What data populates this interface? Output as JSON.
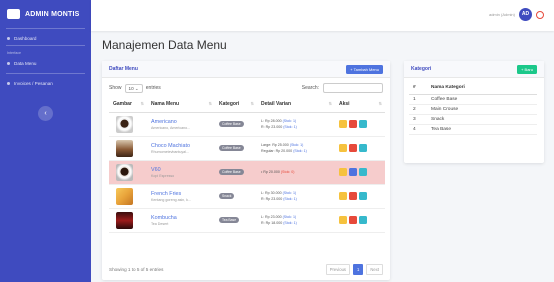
{
  "brand": {
    "name": "ADMIN MONTIS"
  },
  "sidebar": {
    "items": [
      {
        "label": "Dashboard"
      },
      {
        "heading": "Interface"
      },
      {
        "label": "Data Menu"
      },
      {
        "label": "Invoices / Pesanan"
      }
    ]
  },
  "topbar": {
    "user_name": "admin (Admin)",
    "avatar_initials": "AD"
  },
  "page": {
    "title": "Manajemen Data Menu"
  },
  "menu_card": {
    "title": "Daftar Menu",
    "add_button": "+ Tambah Menu",
    "show_label": "Show",
    "entries_value": "10",
    "entries_label": "entries",
    "search_label": "Search:",
    "columns": [
      "Gambar",
      "Nama Menu",
      "Kategori",
      "Detail Varian",
      "Aksi"
    ],
    "rows": [
      {
        "name": "Americano",
        "desc": "Americano, Americano...",
        "category": "Coffee Base",
        "variants": [
          "Rp 28.000",
          "Rp 23.000"
        ],
        "variant_prefix": [
          "L",
          "R"
        ],
        "stock": [
          "(Stok: 1)",
          "(Stok: 1)"
        ],
        "highlight": false
      },
      {
        "name": "Choco Machiato",
        "desc": "Rhumometevbantuyal...",
        "category": "Coffee Base",
        "variants": [
          "Rp 25.000",
          "Rp 20.000"
        ],
        "variant_prefix": [
          "Large",
          "Regular"
        ],
        "stock": [
          "(Stok: 1)",
          "(Stok: 1)"
        ],
        "highlight": false
      },
      {
        "name": "V60",
        "desc": "Kopi Espresso",
        "category": "Coffee Base",
        "variants": [
          "Rp 20.000"
        ],
        "variant_prefix": [
          "•"
        ],
        "stock": [
          "(Stok: 0)"
        ],
        "highlight": true
      },
      {
        "name": "French Fries",
        "desc": "Kentang goreng asin, k...",
        "category": "Snack",
        "variants": [
          "Rp 30.000",
          "Rp 23.000"
        ],
        "variant_prefix": [
          "L",
          "R"
        ],
        "stock": [
          "(Stok: 1)",
          "(Stok: 1)"
        ],
        "highlight": false
      },
      {
        "name": "Kombucha",
        "desc": "Tea Desert",
        "category": "Tea Base",
        "variants": [
          "Rp 23.000",
          "Rp 18.000"
        ],
        "variant_prefix": [
          "L",
          "R"
        ],
        "stock": [
          "(Stok: 1)",
          "(Stok: 1)"
        ],
        "highlight": false
      }
    ],
    "footer_info": "Showing 1 to 5 of 5 entries",
    "pager": {
      "prev": "Previous",
      "current": "1",
      "next": "Next"
    }
  },
  "kategori_card": {
    "title": "Kategori",
    "add_button": "+ Baru",
    "columns": [
      "#",
      "Nama Kategori"
    ],
    "rows": [
      {
        "no": "1",
        "name": "Coffee Base"
      },
      {
        "no": "2",
        "name": "Main Crouse"
      },
      {
        "no": "3",
        "name": "Snack"
      },
      {
        "no": "4",
        "name": "Tea Base"
      }
    ]
  },
  "colors": {
    "primary": "#3f4bbf",
    "accent": "#4e73df",
    "highlight_row": "#f6cccc",
    "warning": "#f6c23e",
    "danger": "#e74a3b",
    "info": "#36b9cc",
    "success": "#1cc88a"
  }
}
